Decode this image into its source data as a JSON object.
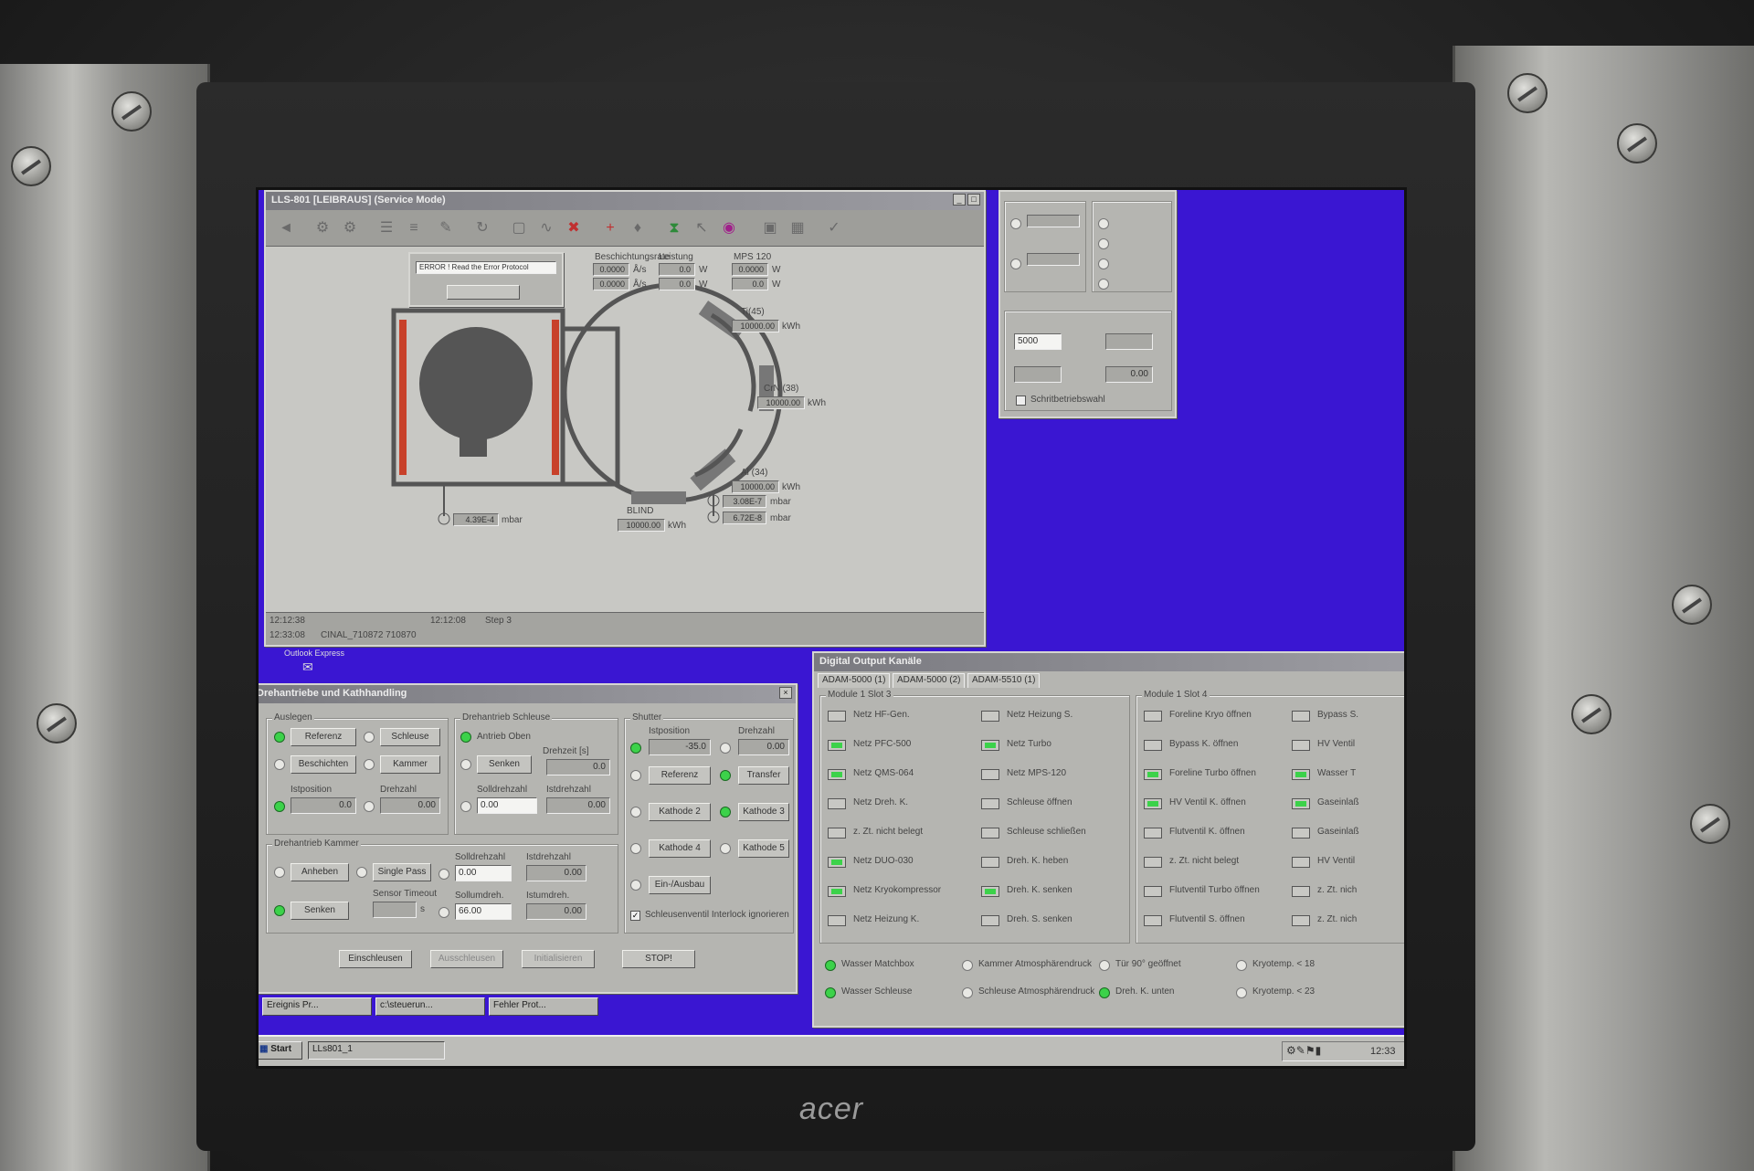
{
  "monitor": {
    "brand": "acer"
  },
  "main_window": {
    "title": "LLS-801 [LEIBRAUS] (Service Mode)",
    "error_popup": {
      "message": "ERROR ! Read the Error Protocol"
    },
    "header_values": [
      {
        "label": "Beschichtungsrate",
        "value1": "0.0000",
        "unit1": "Å/s",
        "value2": "0.0000",
        "unit2": "Å/s"
      },
      {
        "label": "Leistung",
        "value1": "0.0",
        "unit1": "W",
        "value2": "0.0",
        "unit2": "W"
      },
      {
        "label": "MPS 120",
        "value1": "0.0000",
        "unit1": "W",
        "value2": "0.0",
        "unit2": "W"
      }
    ],
    "cathodes": [
      {
        "name": "Ti(45)",
        "value": "10000.00",
        "unit": "kWh"
      },
      {
        "name": "CrN (38)",
        "value": "10000.00",
        "unit": "kWh"
      },
      {
        "name": "Al (34)",
        "value": "10000.00",
        "unit": "kWh"
      },
      {
        "name": "BLIND",
        "value": "10000.00",
        "unit": "kWh"
      }
    ],
    "pressures": [
      {
        "value": "4.39E-4",
        "unit": "mbar"
      },
      {
        "value": "3.08E-7",
        "unit": "mbar"
      },
      {
        "value": "6.72E-8",
        "unit": "mbar"
      }
    ],
    "status_rows": [
      {
        "time": "12:12:38",
        "time2": "12:12:08",
        "text": "Step 3"
      },
      {
        "time": "12:33:08",
        "text": "CINAL_710872 710870"
      }
    ]
  },
  "side_panel": {
    "field1": "5000",
    "field2": "0.00",
    "checkbox_label": "Schritbetriebswahl"
  },
  "drehantrieb": {
    "title": "Drehantriebe und Kathhandling",
    "group1": {
      "title": "Auslegen",
      "b1": "Referenz",
      "b2": "Schleuse",
      "b3": "Beschichten",
      "b4": "Kammer",
      "pos_label": "Istposition",
      "pos_val": "0.0",
      "dz_label": "Drehzahl",
      "dz_val": "0.00"
    },
    "group2": {
      "title": "Drehantrieb Schleuse",
      "antrieb": "Antrieb Oben",
      "senken": "Senken",
      "drehzeit": "Drehzeit [s]",
      "drehzeit_val": "0.0",
      "solldz": "Solldrehzahl",
      "solldz_val": "0.00",
      "istdz": "Istdrehzahl",
      "istdz_val": "0.00"
    },
    "group3": {
      "title": "Shutter",
      "istpos": "Istposition",
      "istpos_val": "-35.0",
      "dz": "Drehzahl",
      "dz_val": "0.00",
      "ref": "Referenz",
      "transfer": "Transfer",
      "k2": "Kathode 2",
      "k3": "Kathode 3",
      "k4": "Kathode 4",
      "k5": "Kathode 5",
      "einaus": "Ein-/Ausbau",
      "interlock": "Schleusenventil Interlock ignorieren"
    },
    "group4": {
      "title": "Drehantrieb Kammer",
      "anheben": "Anheben",
      "single": "Single Pass",
      "senken": "Senken",
      "sensor": "Sensor Timeout",
      "unit_s": "s",
      "solldz": "Solldrehzahl",
      "solldz_val": "0.00",
      "istdz": "Istdrehzahl",
      "istdz_val": "0.00",
      "sollumd": "Sollumdreh.",
      "sollumd_val": "66.00",
      "istumd": "Istumdreh.",
      "istumd_val": "0.00"
    },
    "footer": {
      "b1": "Einschleusen",
      "b2": "Ausschleusen",
      "b3": "Initialisieren",
      "b4": "STOP!"
    }
  },
  "digital_output": {
    "title": "Digital Output Kanäle",
    "tabs": [
      "ADAM-5000 (1)",
      "ADAM-5000 (2)",
      "ADAM-5510 (1)"
    ],
    "slot3": "Module 1 Slot 3",
    "slot4": "Module 1 Slot 4",
    "col1": [
      {
        "label": "Netz HF-Gen.",
        "on": false
      },
      {
        "label": "Netz PFC-500",
        "on": true
      },
      {
        "label": "Netz QMS-064",
        "on": true
      },
      {
        "label": "Netz Dreh. K.",
        "on": false
      },
      {
        "label": "z. Zt. nicht belegt",
        "on": false
      },
      {
        "label": "Netz DUO-030",
        "on": true
      },
      {
        "label": "Netz Kryokompressor",
        "on": true
      },
      {
        "label": "Netz Heizung K.",
        "on": false
      }
    ],
    "col2": [
      {
        "label": "Netz Heizung S.",
        "on": false
      },
      {
        "label": "Netz Turbo",
        "on": true
      },
      {
        "label": "Netz MPS-120",
        "on": false
      },
      {
        "label": "Schleuse öffnen",
        "on": false
      },
      {
        "label": "Schleuse schließen",
        "on": false
      },
      {
        "label": "Dreh. K. heben",
        "on": false
      },
      {
        "label": "Dreh. K. senken",
        "on": true
      },
      {
        "label": "Dreh. S. senken",
        "on": false
      }
    ],
    "col3": [
      {
        "label": "Foreline Kryo öffnen",
        "on": false
      },
      {
        "label": "Bypass K. öffnen",
        "on": false
      },
      {
        "label": "Foreline Turbo öffnen",
        "on": true
      },
      {
        "label": "HV Ventil K. öffnen",
        "on": true
      },
      {
        "label": "Flutventil K. öffnen",
        "on": false
      },
      {
        "label": "z. Zt. nicht belegt",
        "on": false
      },
      {
        "label": "Flutventil Turbo öffnen",
        "on": false
      },
      {
        "label": "Flutventil S. öffnen",
        "on": false
      }
    ],
    "col4": [
      {
        "label": "Bypass S.",
        "on": false
      },
      {
        "label": "HV Ventil",
        "on": false
      },
      {
        "label": "Wasser T",
        "on": true
      },
      {
        "label": "Gaseinlaß",
        "on": true
      },
      {
        "label": "Gaseinlaß",
        "on": false
      },
      {
        "label": "HV Ventil",
        "on": false
      },
      {
        "label": "z. Zt. nich",
        "on": false
      },
      {
        "label": "z. Zt. nich",
        "on": false
      }
    ],
    "inputs": [
      {
        "label": "Wasser Matchbox",
        "on": true
      },
      {
        "label": "Kammer Atmosphärendruck",
        "on": false
      },
      {
        "label": "Tür 90° geöffnet",
        "on": false
      },
      {
        "label": "Kryotemp. < 18",
        "on": false
      },
      {
        "label": "Wasser Schleuse",
        "on": true
      },
      {
        "label": "Schleuse Atmosphärendruck",
        "on": false
      },
      {
        "label": "Dreh. K. unten",
        "on": true
      },
      {
        "label": "Kryotemp. < 23",
        "on": false
      }
    ]
  },
  "taskbar": {
    "start": "Start",
    "app": "LLs801_1",
    "clock": "12:33",
    "minimized": [
      "Ereignis Pr...",
      "c:\\steuerun...",
      "Fehler Prot..."
    ],
    "desktop_icon": "Outlook Express"
  }
}
